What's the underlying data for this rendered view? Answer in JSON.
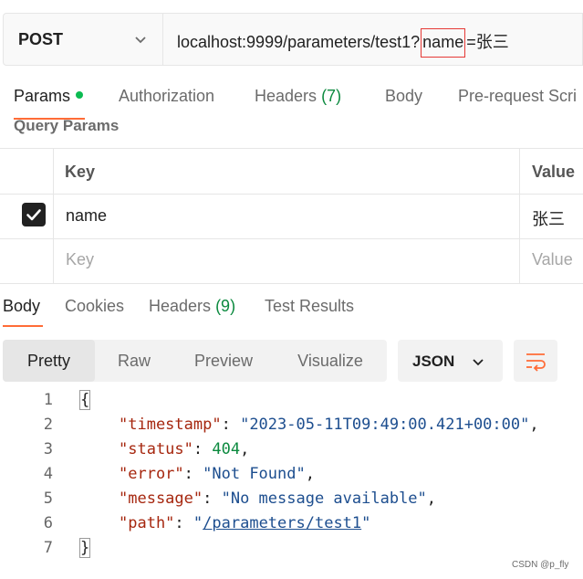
{
  "request": {
    "method": "POST",
    "url_prefix": "localhost:9999/parameters/test1?",
    "url_highlight": "name",
    "url_suffix": "=张三"
  },
  "request_tabs": {
    "params": "Params",
    "authorization": "Authorization",
    "headers_label": "Headers",
    "headers_count": "(7)",
    "body": "Body",
    "pre_request": "Pre-request Scri"
  },
  "query_params": {
    "title": "Query Params",
    "headers": {
      "key": "Key",
      "value": "Value"
    },
    "rows": [
      {
        "checked": true,
        "key": "name",
        "value": "张三"
      }
    ],
    "placeholder": {
      "key": "Key",
      "value": "Value"
    }
  },
  "response_tabs": {
    "body": "Body",
    "cookies": "Cookies",
    "headers_label": "Headers",
    "headers_count": "(9)",
    "test_results": "Test Results"
  },
  "format_toolbar": {
    "modes": [
      "Pretty",
      "Raw",
      "Preview",
      "Visualize"
    ],
    "selected_mode": "Pretty",
    "language": "JSON",
    "wrap_icon": "wrap-lines-icon"
  },
  "response_body": {
    "line_numbers": [
      "1",
      "2",
      "3",
      "4",
      "5",
      "6",
      "7"
    ],
    "open_brace": "{",
    "close_brace": "}",
    "fields": [
      {
        "key": "\"timestamp\"",
        "value": "\"2023-05-11T09:49:00.421+00:00\"",
        "trail": ","
      },
      {
        "key": "\"status\"",
        "value": "404",
        "trail": ","
      },
      {
        "key": "\"error\"",
        "value": "\"Not Found\"",
        "trail": ","
      },
      {
        "key": "\"message\"",
        "value": "\"No message available\"",
        "trail": ","
      },
      {
        "key": "\"path\"",
        "value_open": "\"",
        "value_link": "/parameters/test1",
        "value_close": "\"",
        "trail": ""
      }
    ]
  },
  "watermark": "CSDN @p_fly",
  "colors": {
    "accent": "#ff6c37",
    "status_dot": "#0cbb52",
    "count_green": "#0c8a3f",
    "json_key": "#a6270f",
    "json_string": "#1d4e8f",
    "highlight_box": "#e53935"
  }
}
